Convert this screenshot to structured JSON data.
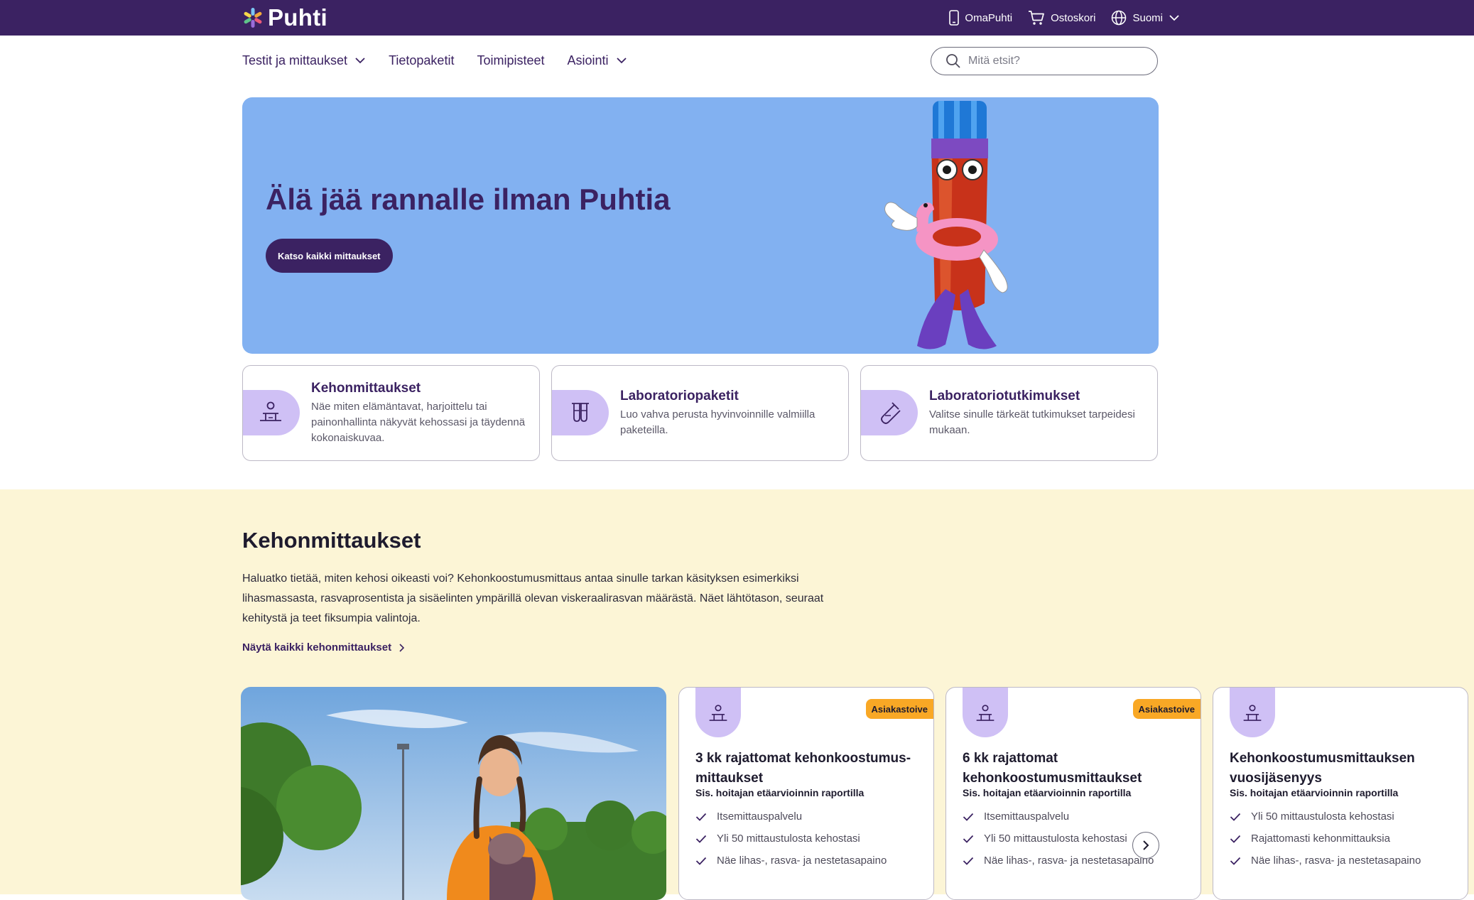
{
  "header": {
    "logo_text": "Puhti",
    "links": [
      {
        "label": "OmaPuhti",
        "icon": "phone-icon"
      },
      {
        "label": "Ostoskori",
        "icon": "cart-icon"
      },
      {
        "label": "Suomi",
        "icon": "globe-icon"
      }
    ],
    "bar_color": "#3b2262"
  },
  "nav": {
    "items": [
      {
        "label": "Testit ja mittaukset",
        "has_dropdown": true
      },
      {
        "label": "Tietopaketit",
        "has_dropdown": false
      },
      {
        "label": "Toimipisteet",
        "has_dropdown": false
      },
      {
        "label": "Asiointi",
        "has_dropdown": true
      }
    ],
    "search_placeholder": "Mitä etsit?"
  },
  "hero": {
    "title": "Älä jää rannalle ilman Puhtia",
    "button_label": "Katso kaikki mittaukset",
    "background": "#82b1f1"
  },
  "categories": [
    {
      "title": "Kehonmittaukset",
      "description": "Näe miten elämäntavat, harjoittelu tai painonhallinta näkyvät kehossasi ja täydennä kokonaiskuvaa.",
      "icon": "body-measure-icon"
    },
    {
      "title": "Laboratoriopaketit",
      "description": "Luo vahva perusta hyvinvoinnille valmiilla paketeilla.",
      "icon": "test-tubes-icon"
    },
    {
      "title": "Laboratoriotutkimukset",
      "description": "Valitse sinulle tärkeät tutkimukset tarpeidesi mukaan.",
      "icon": "test-tube-icon"
    }
  ],
  "section": {
    "title": "Kehonmittaukset",
    "text": "Haluatko tietää, miten kehosi oikeasti voi? Kehonkoostumusmittaus antaa sinulle tarkan käsityksen esimerkiksi lihasmassasta, rasvaprosentista ja sisäelinten ympärillä olevan viskeraalirasvan määrästä. Näet lähtötason, seuraat kehitystä ja teet fiksumpia valintoja.",
    "link_label": "Näytä kaikki kehonmittaukset",
    "background": "#fcf5d6"
  },
  "products": [
    {
      "badge": "Asiakastoive",
      "title": "3 kk rajattomat kehonkoostumus-mittaukset",
      "subtitle": "Sis. hoitajan etäarvioinnin raportilla",
      "features": [
        "Itsemittauspalvelu",
        "Yli 50 mittaustulosta kehostasi",
        "Näe lihas-, rasva- ja nestetasapaino"
      ]
    },
    {
      "badge": "Asiakastoive",
      "title": "6 kk rajattomat kehonkoostumusmittaukset",
      "subtitle": "Sis. hoitajan etäarvioinnin raportilla",
      "features": [
        "Itsemittauspalvelu",
        "Yli 50 mittaustulosta kehostasi",
        "Näe lihas-, rasva- ja nestetasapaino"
      ]
    },
    {
      "badge": "",
      "title": "Kehonkoostumusmittauksen vuosijäsenyys",
      "subtitle": "Sis. hoitajan etäarvioinnin raportilla",
      "features": [
        "Yli 50 mittaustulosta kehostasi",
        "Rajattomasti kehonmittauksia",
        "Näe lihas-, rasva- ja nestetasapaino"
      ]
    }
  ],
  "colors": {
    "brand": "#3b2262",
    "accent_light": "#cfc0f5",
    "badge": "#f9a825"
  }
}
